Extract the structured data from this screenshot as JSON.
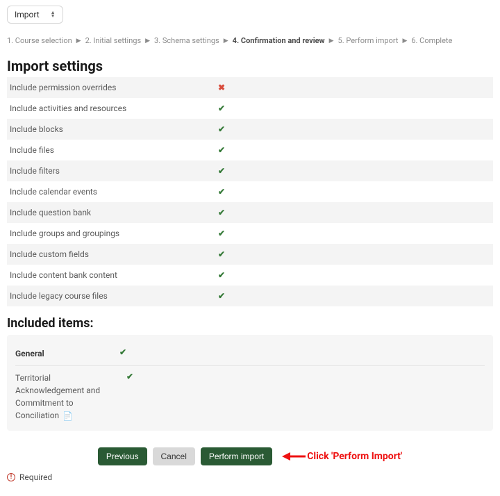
{
  "dropdown": {
    "label": "Import"
  },
  "colors": {
    "accent": "#2a5a34",
    "error": "#c0392b",
    "annotation": "#e11"
  },
  "steps": [
    {
      "label": "1. Course selection",
      "active": false
    },
    {
      "label": "2. Initial settings",
      "active": false
    },
    {
      "label": "3. Schema settings",
      "active": false
    },
    {
      "label": "4. Confirmation and review",
      "active": true
    },
    {
      "label": "5. Perform import",
      "active": false
    },
    {
      "label": "6. Complete",
      "active": false
    }
  ],
  "import_settings": {
    "title": "Import settings",
    "rows": [
      {
        "label": "Include permission overrides",
        "status": "no"
      },
      {
        "label": "Include activities and resources",
        "status": "yes"
      },
      {
        "label": "Include blocks",
        "status": "yes"
      },
      {
        "label": "Include files",
        "status": "yes"
      },
      {
        "label": "Include filters",
        "status": "yes"
      },
      {
        "label": "Include calendar events",
        "status": "yes"
      },
      {
        "label": "Include question bank",
        "status": "yes"
      },
      {
        "label": "Include groups and groupings",
        "status": "yes"
      },
      {
        "label": "Include custom fields",
        "status": "yes"
      },
      {
        "label": "Include content bank content",
        "status": "yes"
      },
      {
        "label": "Include legacy course files",
        "status": "yes"
      }
    ]
  },
  "included_items": {
    "title": "Included items:",
    "sections": [
      {
        "name": "General",
        "status": "yes",
        "items": [
          {
            "label": "Territorial Acknowledgement and Commitment to Conciliation",
            "icon": "page-icon",
            "status": "yes"
          }
        ]
      }
    ]
  },
  "actions": {
    "previous": "Previous",
    "cancel": "Cancel",
    "perform": "Perform import"
  },
  "annotation": {
    "text": "Click 'Perform Import'"
  },
  "footer": {
    "required": "Required"
  }
}
